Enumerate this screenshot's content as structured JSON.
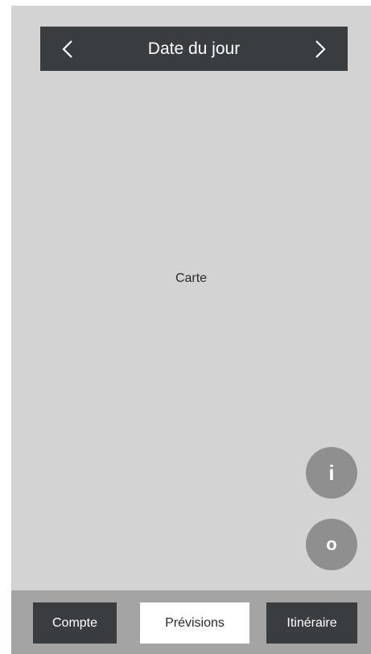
{
  "header": {
    "title": "Date du jour",
    "prev_icon": "chevron-left-icon",
    "next_icon": "chevron-right-icon"
  },
  "map": {
    "label": "Carte"
  },
  "fabs": {
    "info_label": "i",
    "o_label": "o"
  },
  "bottom_nav": {
    "items": [
      {
        "label": "Compte",
        "active": false
      },
      {
        "label": "Prévisions",
        "active": true
      },
      {
        "label": "Itinéraire",
        "active": false
      }
    ]
  },
  "colors": {
    "background": "#d3d3d3",
    "bar_dark": "#3a3d40",
    "bottom_bar": "#a4a4a4",
    "fab": "#8f8f8f",
    "active_tab": "#ffffff"
  }
}
